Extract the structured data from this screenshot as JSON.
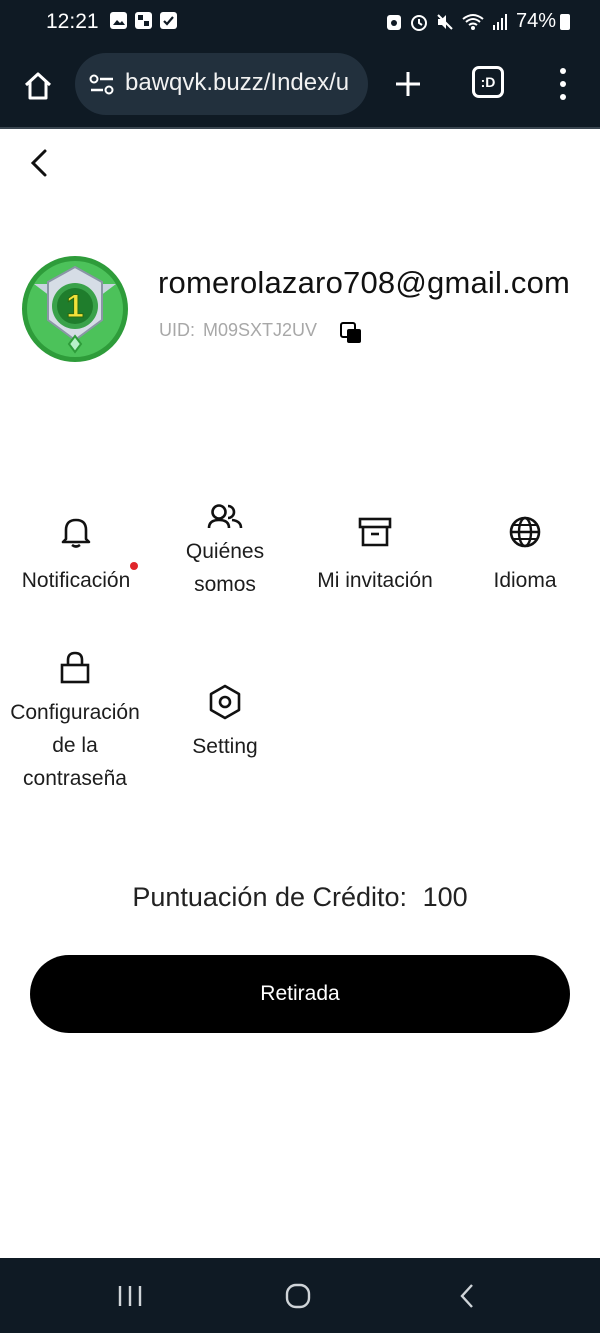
{
  "status_bar": {
    "time": "12:21",
    "battery": "74%",
    "icons": [
      "image-icon",
      "gallery-icon",
      "checkbox-icon",
      "lock-rotate-icon",
      "alarm-icon",
      "mute-icon",
      "wifi-icon",
      "signal-icon",
      "battery-icon"
    ]
  },
  "browser": {
    "url": "bawqvk.buzz/Index/u",
    "tab_label": ":D",
    "icons": [
      "home-icon",
      "tune-icon",
      "plus-icon",
      "tabs-icon",
      "more-vert-icon"
    ]
  },
  "profile": {
    "email": "romerolazaro708@gmail.com",
    "uid_label": "UID:",
    "uid_value": "M09SXTJ2UV",
    "level_badge": "1"
  },
  "menu": {
    "notification": "Notificación",
    "about_line1": "Quiénes",
    "about_line2": "somos",
    "invitation": "Mi invitación",
    "language": "Idioma",
    "password_line1": "Configuración",
    "password_line2": "de la",
    "password_line3": "contraseña",
    "setting": "Setting"
  },
  "credit": {
    "label": "Puntuación de Crédito:",
    "value": "100"
  },
  "withdraw_button": "Retirada",
  "colors": {
    "chrome_bg": "#0f1a24",
    "url_pill": "#22303d",
    "button_bg": "#000000",
    "notification_dot": "#e0262b",
    "uid_text": "#a8a8a8"
  }
}
